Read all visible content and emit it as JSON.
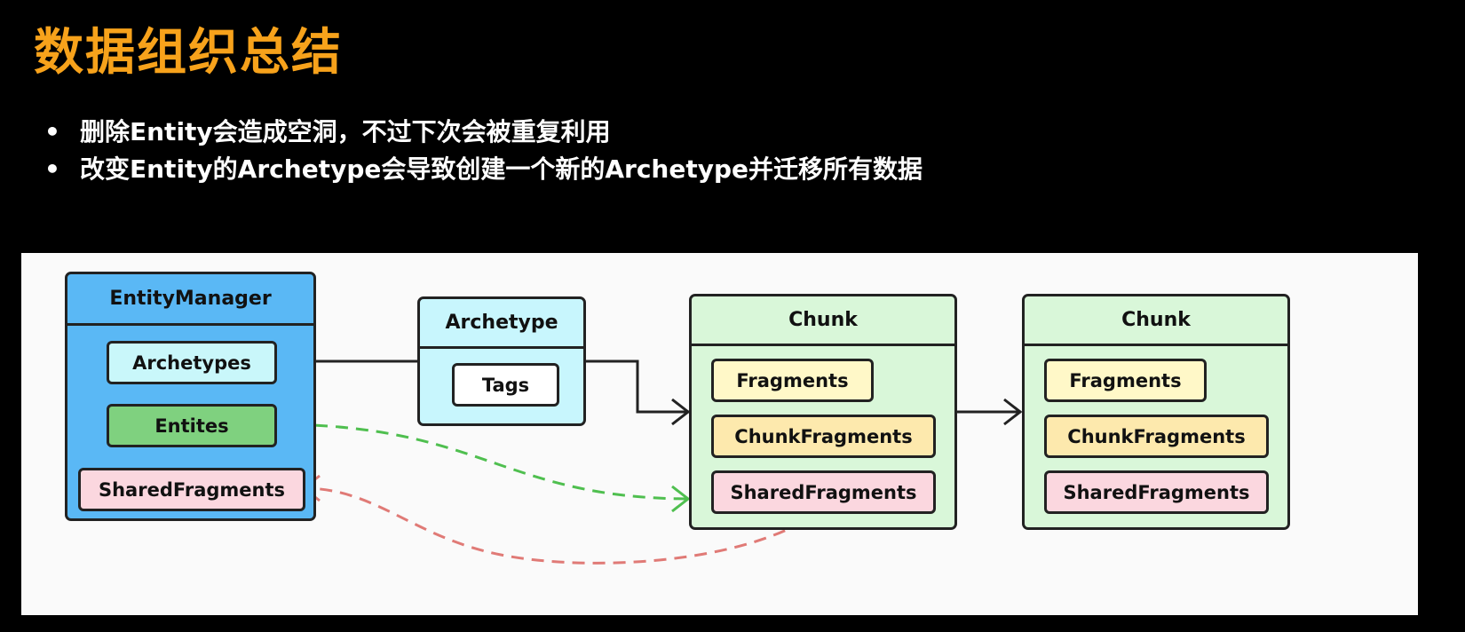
{
  "slide": {
    "title": "数据组织总结",
    "bullets": [
      "删除Entity会造成空洞，不过下次会被重复利用",
      "改变Entity的Archetype会导致创建一个新的Archetype并迁移所有数据"
    ]
  },
  "diagram": {
    "entity_manager": {
      "title": "EntityManager",
      "items": [
        "Archetypes",
        "Entites",
        "SharedFragments"
      ]
    },
    "archetype": {
      "title": "Archetype",
      "items": [
        "Tags"
      ]
    },
    "chunks": [
      {
        "title": "Chunk",
        "items": [
          "Fragments",
          "ChunkFragments",
          "SharedFragments"
        ]
      },
      {
        "title": "Chunk",
        "items": [
          "Fragments",
          "ChunkFragments",
          "SharedFragments"
        ]
      }
    ],
    "colors": {
      "entity_manager_fill": "#5ab8f5",
      "archetypes_item_fill": "#c9f7fa",
      "entites_item_fill": "#7fd17f",
      "shared_fragments_fill": "#fbd7df",
      "archetype_fill": "#c8f6fd",
      "chunk_fill": "#d9f7d9",
      "fragments_fill": "#fff8c8",
      "chunk_fragments_fill": "#fde9ad",
      "green_dashed_link": "#4fbf4f",
      "red_dashed_link": "#e07a76"
    }
  }
}
